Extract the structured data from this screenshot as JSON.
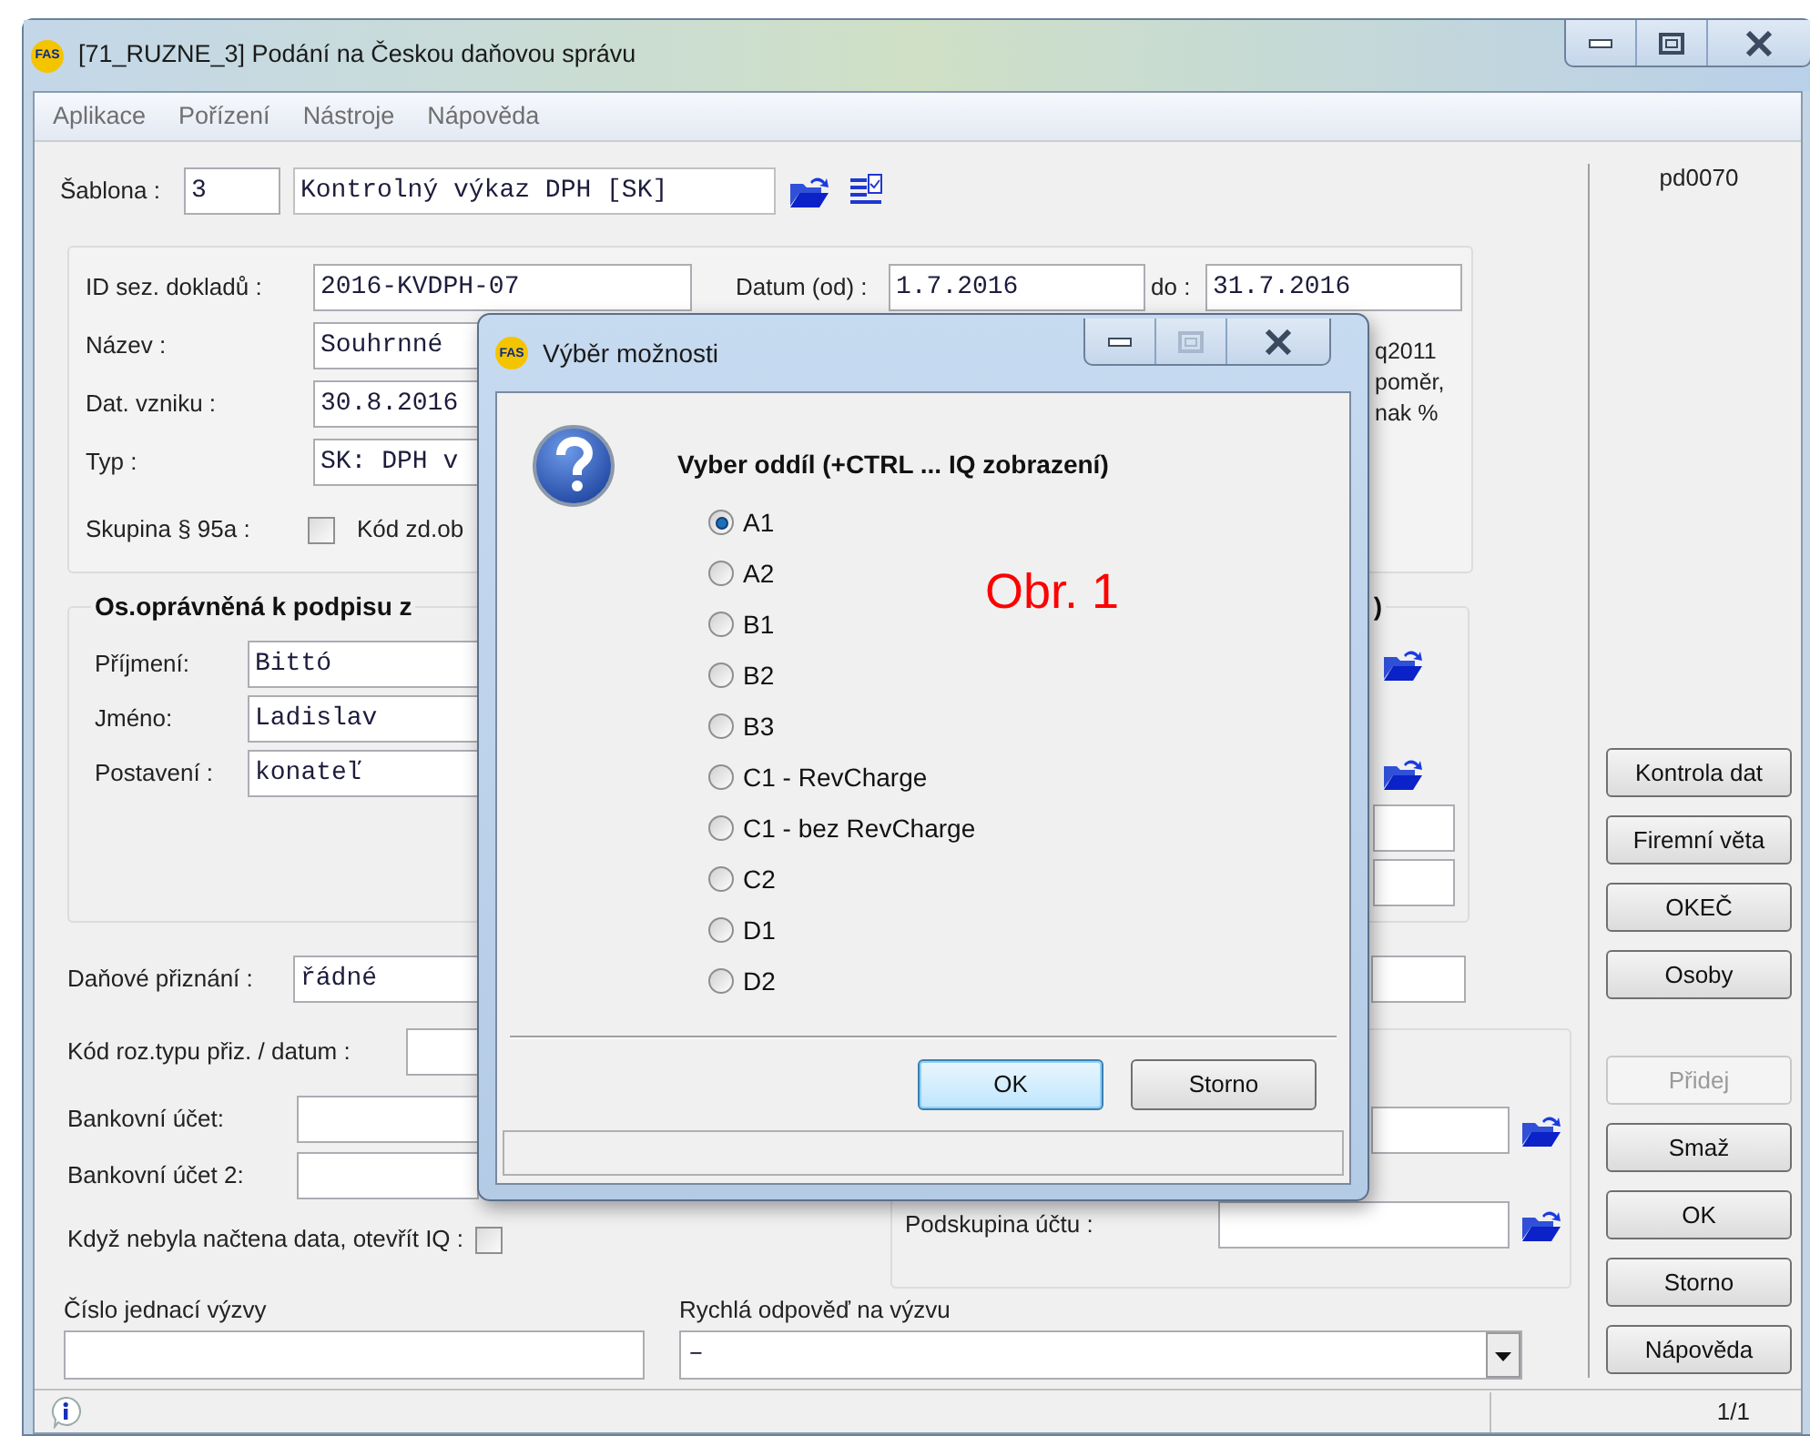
{
  "window": {
    "logo": "FAS",
    "title": "[71_RUZNE_3] Podání na Českou daňovou správu"
  },
  "menu": [
    {
      "label": "Aplikace"
    },
    {
      "label": "Pořízení"
    },
    {
      "label": "Nástroje"
    },
    {
      "label": "Nápověda"
    }
  ],
  "template": {
    "label": "Šablona :",
    "number": "3",
    "name": "Kontrolný výkaz DPH [SK]"
  },
  "form_code": "pd0070",
  "header_group": {
    "rows": [
      {
        "label": "ID sez. dokladů :",
        "value": "2016-KVDPH-07"
      },
      {
        "label": "Název :",
        "value": "Souhrnné"
      },
      {
        "label": "Dat. vzniku :",
        "value": "30.8.2016"
      },
      {
        "label": "Typ :",
        "value": "SK: DPH v"
      }
    ],
    "date_from": {
      "label": "Datum (od) :",
      "value": "1.7.2016"
    },
    "date_to": {
      "label": "do :",
      "value": "31.7.2016"
    },
    "group_check": {
      "label": "Skupina § 95a :",
      "checked": false
    },
    "code_label": "Kód zd.ob",
    "note": [
      "q2011",
      "poměr,",
      "nak %"
    ]
  },
  "signatory": {
    "title": "Os.oprávněná k podpisu z",
    "right_title": ")",
    "fields": [
      {
        "label": "Příjmení:",
        "value": "Bittó",
        "browse": true
      },
      {
        "label": "Jméno:",
        "value": "Ladislav",
        "browse": false
      },
      {
        "label": "Postavení :",
        "value": "konateľ",
        "browse": true
      }
    ]
  },
  "tax_return": {
    "label": "Daňové přiznání :",
    "value": "řádné"
  },
  "correction": {
    "label": "Kód roz.typu přiz. / datum :"
  },
  "bank_accounts": [
    {
      "label": "Bankovní účet:"
    },
    {
      "label": "Bankovní účet 2:"
    }
  ],
  "open_iq": {
    "label": "Když nebyla načtena data, otevřít IQ :",
    "checked": false
  },
  "subgroup": {
    "label": "Podskupina účtu :"
  },
  "reference": {
    "label": "Číslo jednací výzvy"
  },
  "quick_reply": {
    "label": "Rychlá odpověď na výzvu",
    "value": "–"
  },
  "side_buttons_top": [
    {
      "label": "Kontrola dat",
      "disabled": false
    },
    {
      "label": "Firemní věta",
      "disabled": false
    },
    {
      "label": "OKEČ",
      "disabled": false
    },
    {
      "label": "Osoby",
      "disabled": false
    }
  ],
  "side_buttons_bottom": [
    {
      "label": "Přidej",
      "disabled": true
    },
    {
      "label": "Smaž",
      "disabled": false
    },
    {
      "label": "OK",
      "disabled": false
    },
    {
      "label": "Storno",
      "disabled": false
    },
    {
      "label": "Nápověda",
      "disabled": false
    }
  ],
  "status_bar": {
    "page": "1/1"
  },
  "dialog": {
    "logo": "FAS",
    "title": "Výběr možnosti",
    "prompt": "Vyber oddíl (+CTRL ... IQ zobrazení)",
    "annotation": "Obr. 1",
    "options": [
      {
        "label": "A1",
        "selected": true
      },
      {
        "label": "A2",
        "selected": false
      },
      {
        "label": "B1",
        "selected": false
      },
      {
        "label": "B2",
        "selected": false
      },
      {
        "label": "B3",
        "selected": false
      },
      {
        "label": "C1 - RevCharge",
        "selected": false
      },
      {
        "label": "C1 - bez RevCharge",
        "selected": false
      },
      {
        "label": "C2",
        "selected": false
      },
      {
        "label": "D1",
        "selected": false
      },
      {
        "label": "D2",
        "selected": false
      }
    ],
    "buttons": [
      {
        "label": "OK",
        "default": true
      },
      {
        "label": "Storno",
        "default": false
      }
    ]
  }
}
